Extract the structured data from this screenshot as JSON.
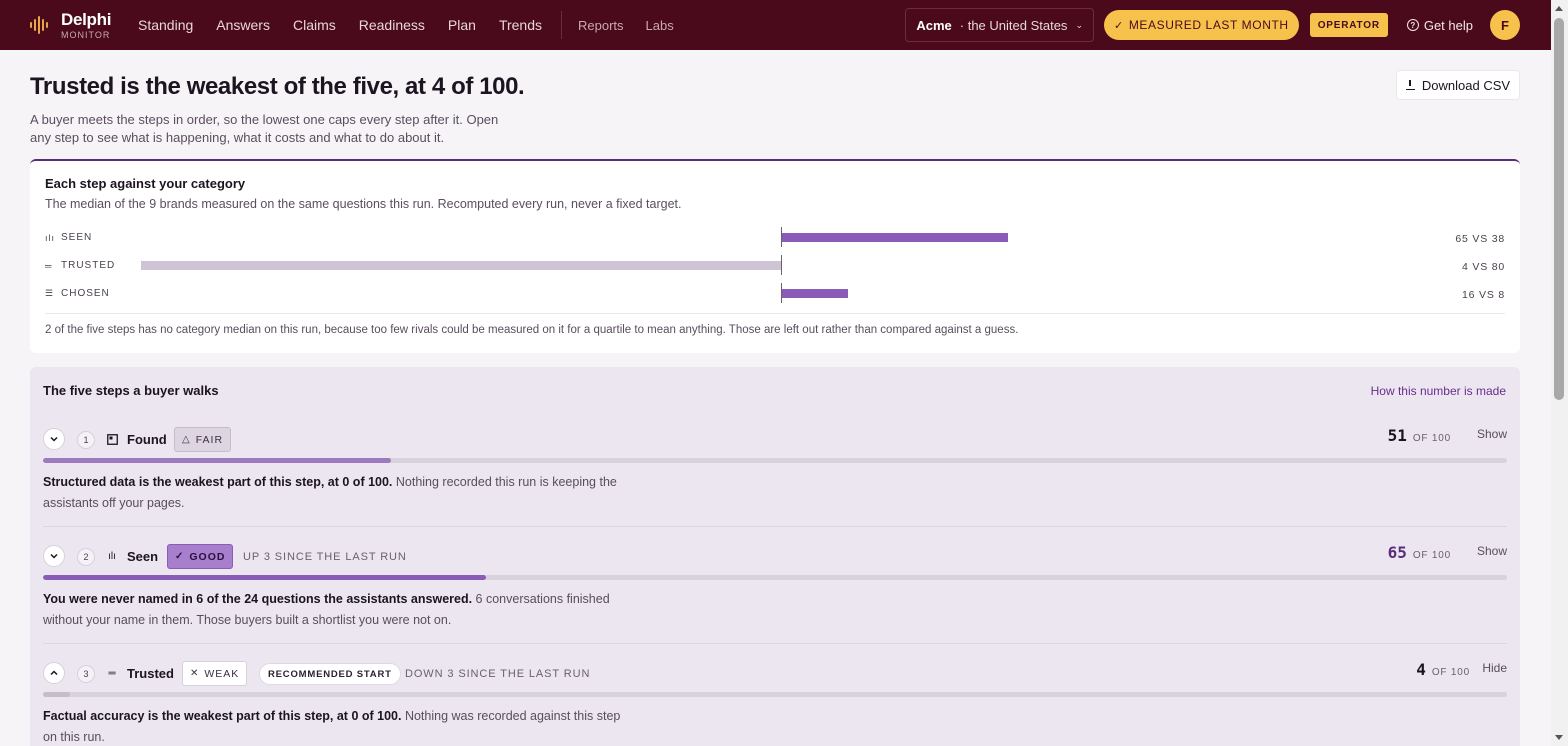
{
  "nav": {
    "brand_name": "Delphi",
    "brand_sub": "MONITOR",
    "links": [
      "Standing",
      "Answers",
      "Claims",
      "Readiness",
      "Plan",
      "Trends"
    ],
    "secondary_links": [
      "Reports",
      "Labs"
    ],
    "market_brand": "Acme",
    "market_region": "· the United States",
    "measured_label": "MEASURED LAST MONTH",
    "operator_label": "OPERATOR",
    "help_label": "Get help",
    "avatar_initial": "F"
  },
  "header": {
    "title": "Trusted is the weakest of the five, at 4 of 100.",
    "description": "A buyer meets the steps in order, so the lowest one caps every step after it. Open any step to see what is happening, what it costs and what to do about it.",
    "download_label": "Download CSV"
  },
  "category": {
    "title": "Each step against your category",
    "subtitle": "The median of the 9 brands measured on the same questions this run. Recomputed every run, never a fixed target.",
    "rows": [
      {
        "label": "SEEN",
        "icon": "signal-icon",
        "score": 65,
        "median": 38,
        "value_text": "65 VS 38"
      },
      {
        "label": "TRUSTED",
        "icon": "equals-icon",
        "score": 4,
        "median": 80,
        "value_text": "4 VS 80"
      },
      {
        "label": "CHOSEN",
        "icon": "list-check-icon",
        "score": 16,
        "median": 8,
        "value_text": "16 VS 8"
      }
    ],
    "note": "2 of the five steps has no category median on this run, because too few rivals could be measured on it for a quartile to mean anything. Those are left out rather than compared against a guess."
  },
  "steps": {
    "title": "The five steps a buyer walks",
    "method_link": "How this number is made",
    "of_label": "OF 100",
    "items": [
      {
        "num": "1",
        "name": "Found",
        "icon": "page-icon",
        "badge": "FAIR",
        "badge_icon": "△",
        "delta": "",
        "recommended": "",
        "score": 51,
        "toggle": "Show",
        "expanded": false,
        "body_bold": "Structured data is the weakest part of this step, at 0 of 100.",
        "body_rest": " Nothing recorded this run is keeping the assistants off your pages."
      },
      {
        "num": "2",
        "name": "Seen",
        "icon": "signal-icon",
        "badge": "GOOD",
        "badge_icon": "✓",
        "delta": "UP 3 SINCE THE LAST RUN",
        "recommended": "",
        "score": 65,
        "toggle": "Show",
        "expanded": false,
        "body_bold": "You were never named in 6 of the 24 questions the assistants answered.",
        "body_rest": " 6 conversations finished without your name in them. Those buyers built a shortlist you were not on."
      },
      {
        "num": "3",
        "name": "Trusted",
        "icon": "equals-icon",
        "badge": "WEAK",
        "badge_icon": "✕",
        "delta": "DOWN 3 SINCE THE LAST RUN",
        "recommended": "RECOMMENDED START",
        "score": 4,
        "toggle": "Hide",
        "expanded": true,
        "body_bold": "Factual accuracy is the weakest part of this step, at 0 of 100.",
        "body_rest": " Nothing was recorded against this step on this run."
      }
    ]
  }
}
